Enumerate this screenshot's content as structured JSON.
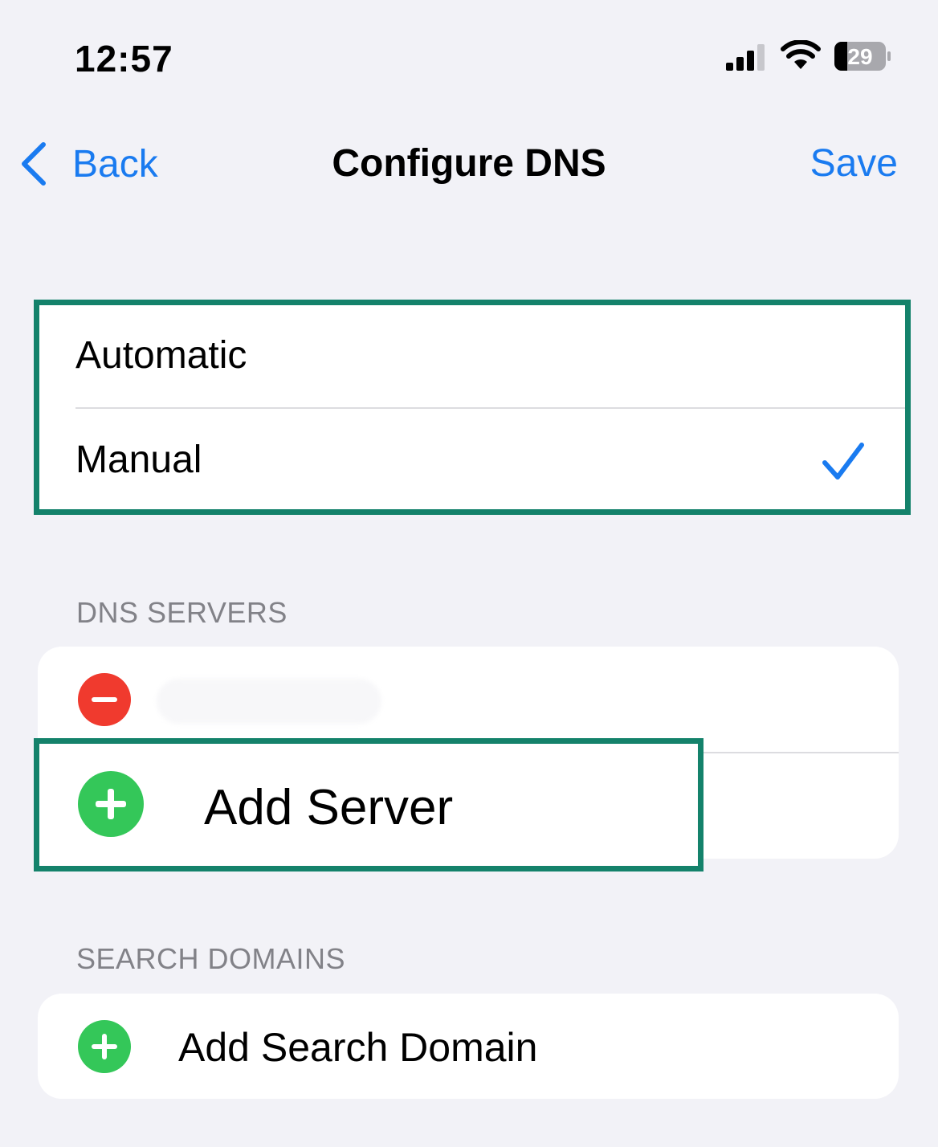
{
  "status_bar": {
    "time": "12:57",
    "battery": "29",
    "icons": [
      "cellular-signal-icon",
      "wifi-icon",
      "battery-icon"
    ]
  },
  "nav": {
    "back_label": "Back",
    "title": "Configure DNS",
    "save_label": "Save",
    "accent_color": "#1a7bf0"
  },
  "mode": {
    "options": [
      {
        "label": "Automatic",
        "selected": false
      },
      {
        "label": "Manual",
        "selected": true
      }
    ],
    "highlight_color": "#14826b"
  },
  "dns_servers": {
    "header": "DNS SERVERS",
    "add_label": "Add Server"
  },
  "search_domains": {
    "header": "SEARCH DOMAINS",
    "add_label": "Add Search Domain"
  },
  "colors": {
    "background": "#f2f2f7",
    "remove": "#f03a2e",
    "add": "#34c759"
  }
}
